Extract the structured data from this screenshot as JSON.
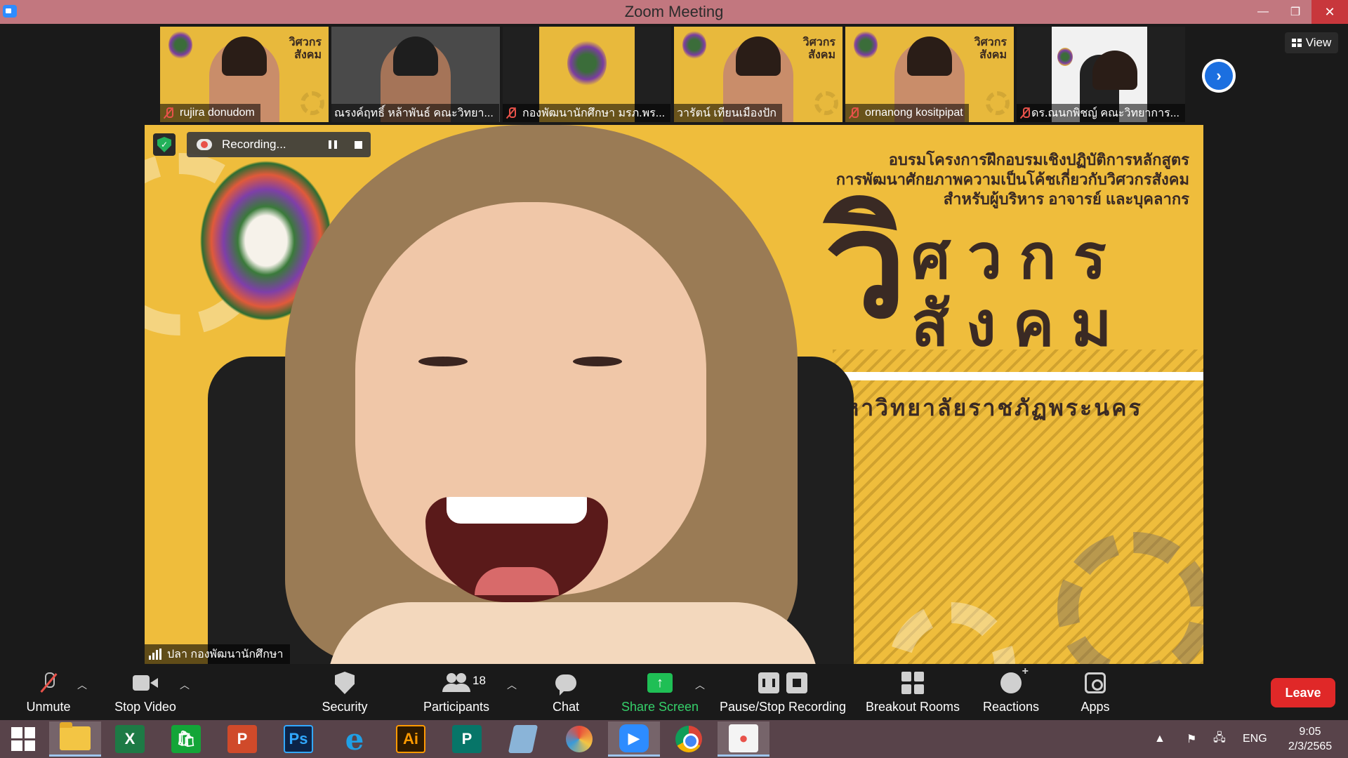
{
  "window": {
    "title": "Zoom Meeting",
    "controls": {
      "minimize": "—",
      "maximize": "❐",
      "close": "✕"
    }
  },
  "gallery": {
    "participants": [
      {
        "name": "rujira donudom",
        "muted": true
      },
      {
        "name": "ณรงค์ฤทธิ์ หล้าพันธ์ คณะวิทยา...",
        "muted": false
      },
      {
        "name": "กองพัฒนานักศึกษา มรภ.พร...",
        "muted": true
      },
      {
        "name": "วารัตน์ เทียนเมืองปัก",
        "muted": false
      },
      {
        "name": "ornanong kositpipat",
        "muted": true
      },
      {
        "name": "ดร.ณนกพิชญ์ คณะวิทยาการ...",
        "muted": true
      }
    ],
    "thumb_brand": "วิศวกร\nสังคม",
    "next_page_icon": "chevron-right-icon",
    "view_label": "View"
  },
  "speaker": {
    "name": "ปลา กองพัฒนานักศึกษา",
    "recording_label": "Recording...",
    "poster": {
      "line1": "อบรมโครงการฝึกอบรมเชิงปฏิบัติการหลักสูตร",
      "line2": "การพัฒนาศักยภาพความเป็นโค้ชเกี่ยวกับวิศวกรสังคม",
      "line3": "สำหรับผู้บริหาร อาจารย์ และบุคลากร",
      "big_vi": "วิ",
      "big_line1": "ศวกร",
      "big_line2": "สังคม",
      "university": "มหาวิทยาลัยราชภัฏพระนคร"
    }
  },
  "toolbar": {
    "unmute": "Unmute",
    "stop_video": "Stop Video",
    "security": "Security",
    "participants": "Participants",
    "participant_count": "18",
    "chat": "Chat",
    "share_screen": "Share Screen",
    "pause_stop_recording": "Pause/Stop Recording",
    "breakout_rooms": "Breakout Rooms",
    "reactions": "Reactions",
    "apps": "Apps",
    "leave": "Leave",
    "share_color": "#1fbf55",
    "leave_color": "#e02828"
  },
  "taskbar": {
    "apps": [
      "start",
      "file-explorer",
      "excel",
      "publisher-green",
      "powerpoint",
      "photoshop",
      "internet-explorer",
      "illustrator",
      "publisher",
      "notepad",
      "photoscape",
      "zoom",
      "chrome",
      "photo-app"
    ],
    "labels": {
      "excel": "X",
      "store": "",
      "powerpoint": "P",
      "photoshop": "Ps",
      "illustrator": "Ai",
      "publisher": "P"
    },
    "language": "ENG",
    "time": "9:05",
    "date": "2/3/2565"
  }
}
